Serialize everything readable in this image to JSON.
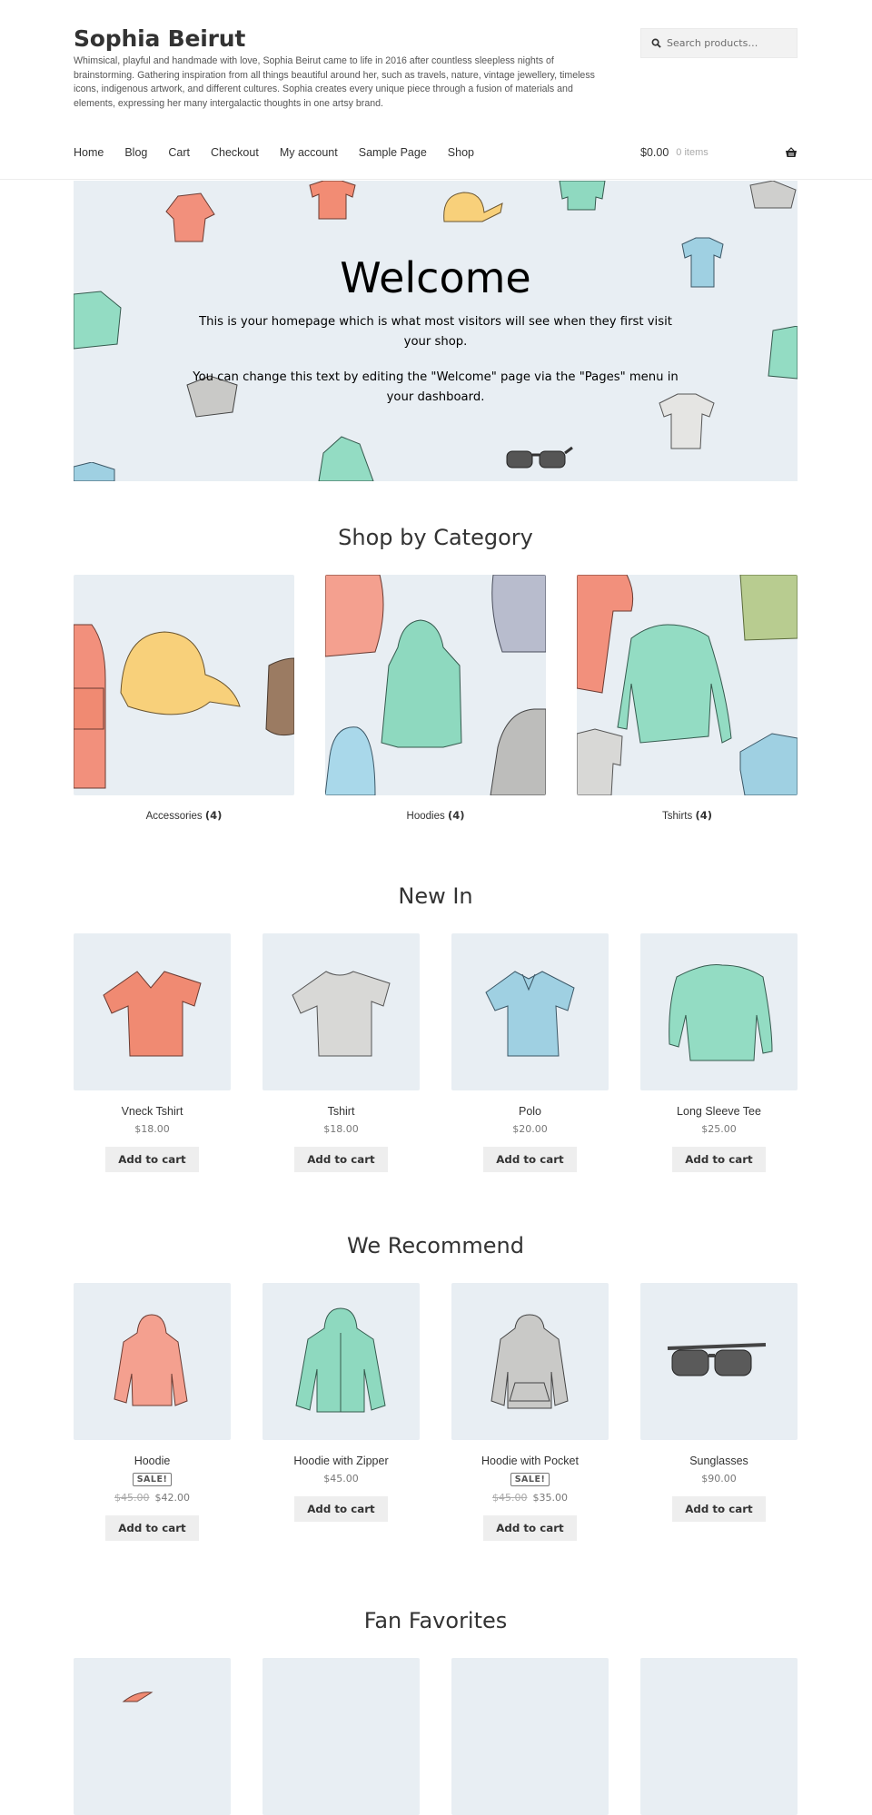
{
  "header": {
    "site_title": "Sophia Beirut",
    "site_description": "Whimsical, playful and handmade with love, Sophia Beirut came to life in 2016 after countless sleepless nights of brainstorming. Gathering inspiration from all things beautiful around her, such as travels, nature, vintage jewellery, timeless icons, indigenous artwork, and different cultures. Sophia creates every unique piece through a fusion of materials and elements, expressing her many intergalactic thoughts in one artsy brand.",
    "search_placeholder": "Search products…",
    "search_icon": "search-icon",
    "nav": [
      "Home",
      "Blog",
      "Cart",
      "Checkout",
      "My account",
      "Sample Page",
      "Shop"
    ],
    "cart": {
      "amount": "$0.00",
      "count": "0 items",
      "icon": "basket-icon"
    }
  },
  "hero": {
    "title": "Welcome",
    "paragraph1": [
      "This is your homepage which is what most visitors will see when they first visit",
      "your shop."
    ],
    "paragraph2": [
      "You can change this text by editing the \"Welcome\" page via the \"Pages\" menu in",
      "your dashboard."
    ]
  },
  "categories_section": {
    "title": "Shop by Category",
    "items": [
      {
        "name": "Accessories",
        "count": "(4)"
      },
      {
        "name": "Hoodies",
        "count": "(4)"
      },
      {
        "name": "Tshirts",
        "count": "(4)"
      }
    ]
  },
  "new_in": {
    "title": "New In",
    "products": [
      {
        "name": "Vneck Tshirt",
        "price": "$18.00",
        "button": "Add to cart",
        "color": "#f08a72"
      },
      {
        "name": "Tshirt",
        "price": "$18.00",
        "button": "Add to cart",
        "color": "#d8d8d6"
      },
      {
        "name": "Polo",
        "price": "$20.00",
        "button": "Add to cart",
        "color": "#9fd0e2"
      },
      {
        "name": "Long Sleeve Tee",
        "price": "$25.00",
        "button": "Add to cart",
        "color": "#93dcc3"
      }
    ]
  },
  "recommend": {
    "title": "We Recommend",
    "products": [
      {
        "name": "Hoodie",
        "sale_badge": "SALE!",
        "old_price": "$45.00",
        "price": "$42.00",
        "button": "Add to cart",
        "color": "#f4a08f"
      },
      {
        "name": "Hoodie with Zipper",
        "price": "$45.00",
        "button": "Add to cart",
        "color": "#8ed9bf"
      },
      {
        "name": "Hoodie with Pocket",
        "sale_badge": "SALE!",
        "old_price": "$45.00",
        "price": "$35.00",
        "button": "Add to cart",
        "color": "#c9c9c7"
      },
      {
        "name": "Sunglasses",
        "price": "$90.00",
        "button": "Add to cart",
        "color": "#555555"
      }
    ]
  },
  "fan_favorites": {
    "title": "Fan Favorites"
  },
  "colors": {
    "panel_bg": "#e8eef3",
    "button_bg": "#eeeeee",
    "text": "#333333"
  }
}
